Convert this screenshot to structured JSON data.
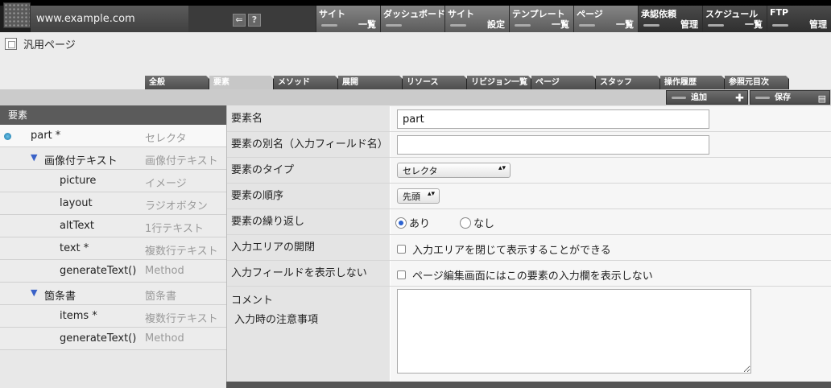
{
  "header": {
    "url": "www.example.com",
    "nav": [
      {
        "title": "サイト",
        "sub": "一覧",
        "dark": false
      },
      {
        "title": "ダッシュボード",
        "sub": "",
        "dark": false
      },
      {
        "title": "サイト",
        "sub": "設定",
        "dark": false
      },
      {
        "title": "テンプレート",
        "sub": "一覧",
        "dark": false
      },
      {
        "title": "ページ",
        "sub": "一覧",
        "dark": false
      },
      {
        "title": "承認依頼",
        "sub": "管理",
        "dark": true
      },
      {
        "title": "スケジュール",
        "sub": "一覧",
        "dark": true
      },
      {
        "title": "FTP",
        "sub": "管理",
        "dark": true
      }
    ],
    "icons": [
      "arrow-left-icon",
      "help-icon"
    ]
  },
  "page": {
    "title": "汎用ページ"
  },
  "tabs": [
    "全般",
    "要素",
    "メソッド",
    "展開",
    "リソース",
    "リビジョン一覧",
    "ページ",
    "スタッフ",
    "操作履歴",
    "参照元目次"
  ],
  "active_tab": 1,
  "actions": {
    "add_label": "追加",
    "save_label": "保存"
  },
  "element_list": {
    "header": "要素",
    "items": [
      {
        "name": "part *",
        "type": "セレクタ",
        "level": 0,
        "selected": true,
        "marker": "dot"
      },
      {
        "name": "画像付テキスト",
        "type": "画像付テキスト",
        "level": 1,
        "marker": "triangle"
      },
      {
        "name": "picture",
        "type": "イメージ",
        "level": 2
      },
      {
        "name": "layout",
        "type": "ラジオボタン",
        "level": 2
      },
      {
        "name": "altText",
        "type": "1行テキスト",
        "level": 2
      },
      {
        "name": "text *",
        "type": "複数行テキスト",
        "level": 2
      },
      {
        "name": "generateText()",
        "type": "Method",
        "level": 2
      },
      {
        "name": "箇条書",
        "type": "箇条書",
        "level": 1,
        "marker": "triangle"
      },
      {
        "name": "items *",
        "type": "複数行テキスト",
        "level": 2
      },
      {
        "name": "generateText()",
        "type": "Method",
        "level": 2
      }
    ]
  },
  "form": {
    "name_label": "要素名",
    "name_value": "part",
    "alias_label": "要素の別名（入力フィールド名）",
    "alias_value": "",
    "type_label": "要素のタイプ",
    "type_value": "セレクタ",
    "order_label": "要素の順序",
    "order_value": "先頭",
    "repeat_label": "要素の繰り返し",
    "repeat_yes": "あり",
    "repeat_no": "なし",
    "repeat_selected": "あり",
    "collapse_label": "入力エリアの開閉",
    "collapse_text": "入力エリアを閉じて表示することができる",
    "hide_label": "入力フィールドを表示しない",
    "hide_text": "ページ編集画面にはこの要素の入力欄を表示しない",
    "comment_label": "コメント",
    "comment_sub": "入力時の注意事項",
    "comment_value": ""
  }
}
